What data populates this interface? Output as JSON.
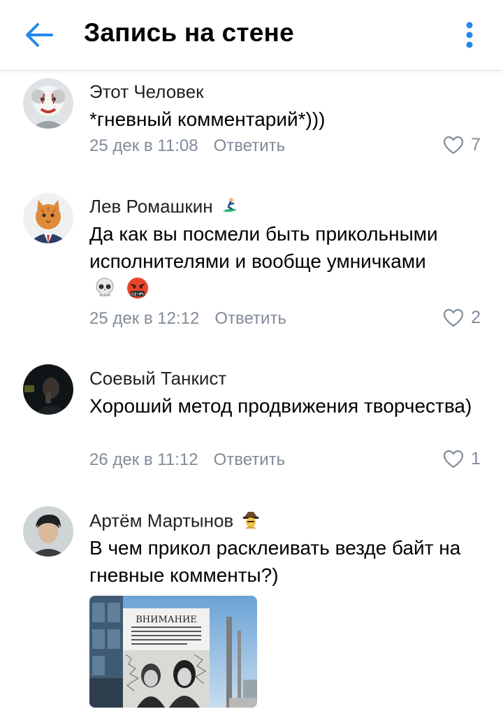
{
  "header": {
    "title": "Запись на стене",
    "back_icon": "arrow-left-icon",
    "more_icon": "more-vertical-icon",
    "accent": "#2688eb"
  },
  "colors": {
    "meta": "#818c99",
    "text": "#000000"
  },
  "comments": [
    {
      "author": "Этот Человек",
      "text": "*гневный комментарий*)))",
      "date": "25 дек в 11:08",
      "reply": "Ответить",
      "likes": "7"
    },
    {
      "author": "Лев Ромашкин",
      "author_badge": "surfer-emoji",
      "text": "Да как вы посмели быть прикольными исполнителями и вообще умничками",
      "emojis": [
        "skull-emoji",
        "cursing-face-emoji"
      ],
      "date": "25 дек в 12:12",
      "reply": "Ответить",
      "likes": "2"
    },
    {
      "author": "Соевый Танкист",
      "text": "Хороший метод продвижения творчества)",
      "date": "26 дек в 11:12",
      "reply": "Ответить",
      "likes": "1"
    },
    {
      "author": "Артём Мартынов",
      "author_badge": "detective-emoji",
      "text": "В чем прикол расклеивать везде байт на гневные комменты?)",
      "attachment": {
        "type": "photo",
        "poster_heading": "ВНИМАНИЕ"
      }
    }
  ]
}
